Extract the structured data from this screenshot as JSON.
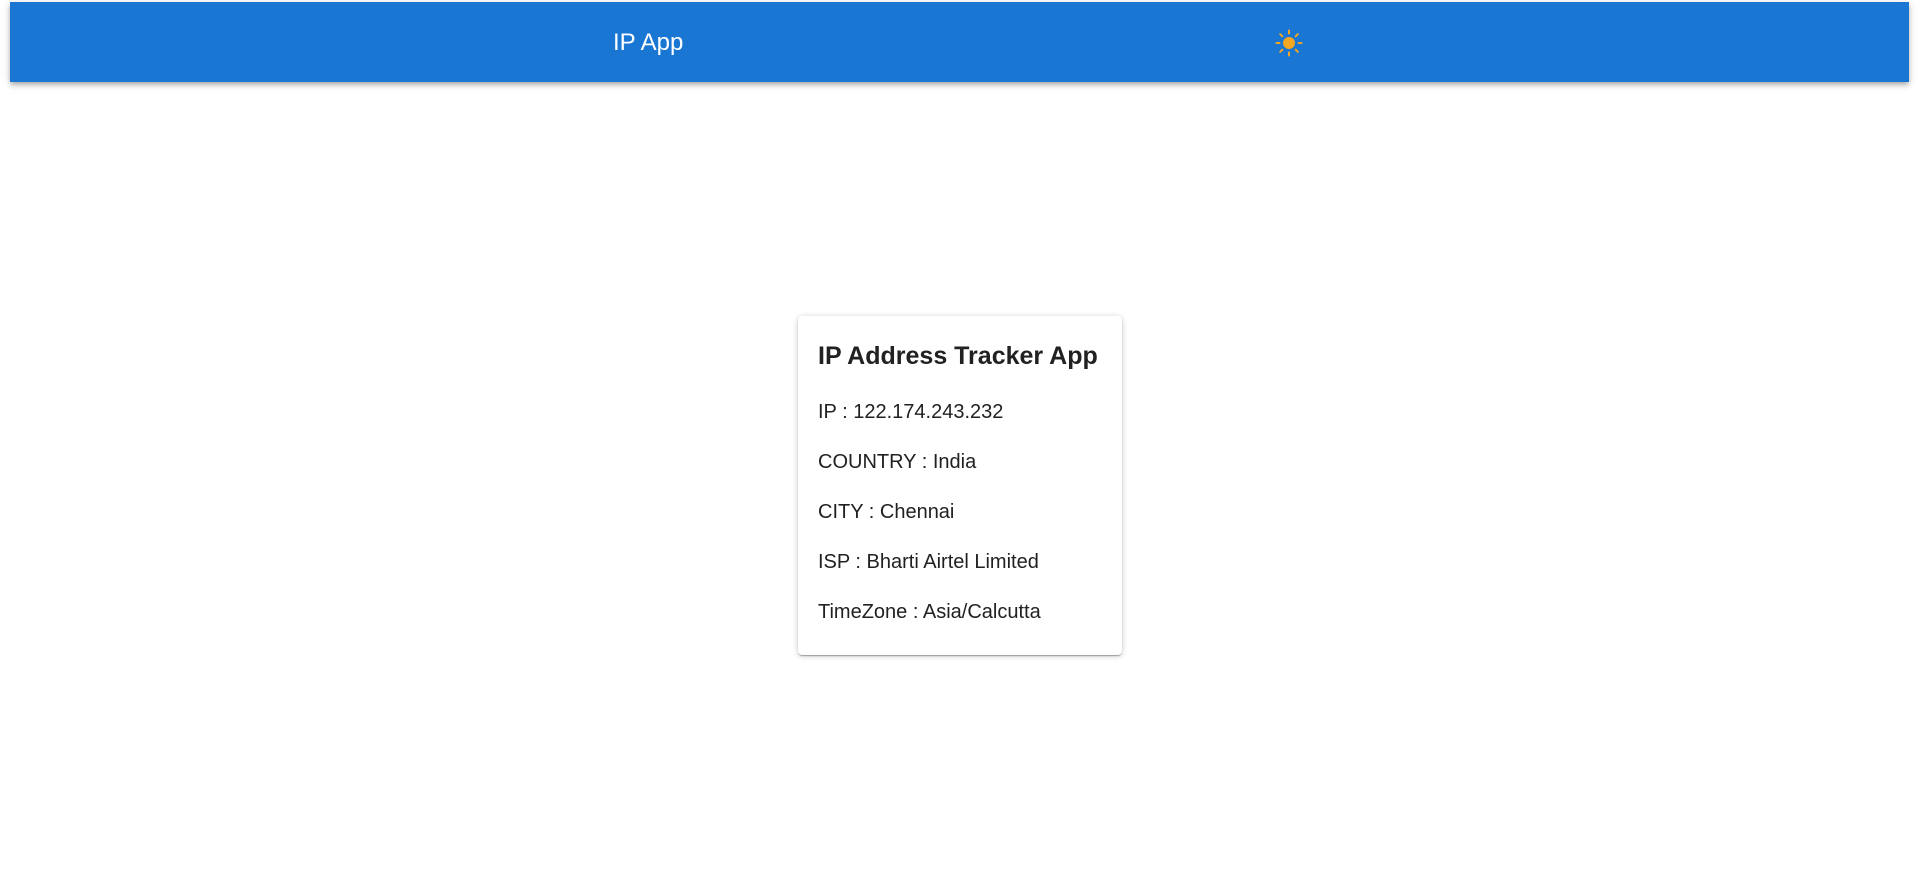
{
  "appbar": {
    "title": "IP App",
    "theme_icon": "sun-icon",
    "background_color": "#1976d2",
    "icon_color": "#f5a623"
  },
  "card": {
    "title": "IP Address Tracker App",
    "rows": [
      {
        "label": "IP",
        "value": "122.174.243.232"
      },
      {
        "label": "COUNTRY",
        "value": "India"
      },
      {
        "label": "CITY",
        "value": "Chennai"
      },
      {
        "label": "ISP",
        "value": "Bharti Airtel Limited"
      },
      {
        "label": "TimeZone",
        "value": "Asia/Calcutta"
      }
    ]
  }
}
